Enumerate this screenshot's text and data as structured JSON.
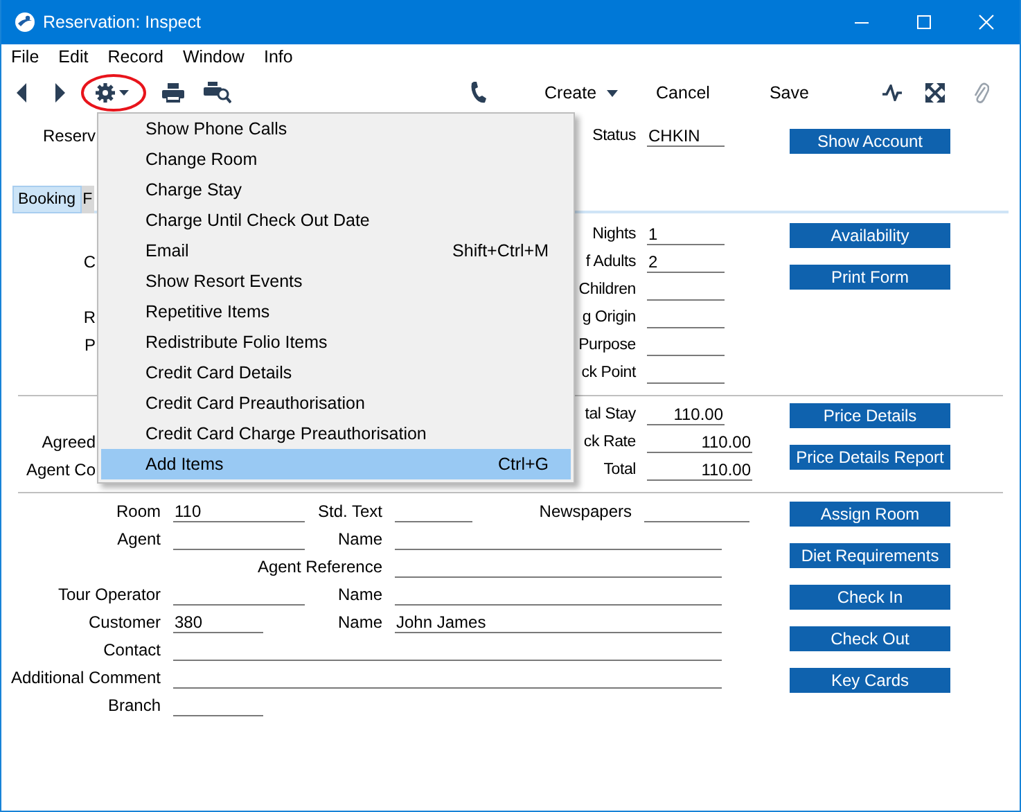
{
  "window": {
    "title": "Reservation: Inspect"
  },
  "menubar": [
    {
      "label": "File"
    },
    {
      "label": "Edit"
    },
    {
      "label": "Record"
    },
    {
      "label": "Window"
    },
    {
      "label": "Info"
    }
  ],
  "toolbar": {
    "buttons": [
      {
        "label": "Create",
        "kind": "dropdown"
      },
      {
        "label": "Cancel",
        "kind": "plain"
      },
      {
        "label": "Save",
        "kind": "plain"
      }
    ]
  },
  "header": {
    "left_label": "Reserv",
    "status_label": "Status",
    "status_value": "CHKIN",
    "button": "Show Account"
  },
  "tabs": [
    {
      "label": "Booking",
      "selected": true
    },
    {
      "label": "F",
      "selected": false
    }
  ],
  "booking": {
    "rows": [
      {
        "label": "Nights",
        "value": "1"
      },
      {
        "left_label": "C",
        "label": "f Adults",
        "value": "2"
      },
      {
        "label": "Children"
      },
      {
        "left_label": "R",
        "label": "g Origin"
      },
      {
        "left_label": "P",
        "label": "Purpose"
      },
      {
        "label": "ck Point"
      }
    ],
    "buttons": [
      "Availability",
      "Print Form"
    ]
  },
  "prices": {
    "rows": [
      {
        "label": "tal Stay",
        "value": "110.00"
      },
      {
        "left_label": "Agreed",
        "label": "ck Rate",
        "value": "110.00"
      },
      {
        "left_label": "Agent Co",
        "label": "Total",
        "value": "110.00"
      }
    ],
    "buttons": [
      "Price Details",
      "Price Details Report"
    ]
  },
  "guest": {
    "rows": [
      [
        {
          "label": "Room",
          "value": "110"
        },
        {
          "label": "Std. Text"
        },
        {
          "label": "Newspapers"
        }
      ],
      [
        {
          "label": "Agent"
        },
        {
          "label": "Name"
        }
      ],
      [
        {},
        {
          "label": "Agent Reference"
        }
      ],
      [
        {
          "label": "Tour Operator"
        },
        {
          "label": "Name"
        }
      ],
      [
        {
          "label": "Customer",
          "value": "380"
        },
        {
          "label": "Name",
          "value": "John James"
        }
      ],
      [
        {
          "label": "Contact"
        }
      ],
      [
        {
          "label": "Additional Comment"
        }
      ],
      [
        {
          "label": "Branch"
        }
      ]
    ],
    "buttons": [
      "Assign Room",
      "Diet Requirements",
      "Check In",
      "Check Out",
      "Key Cards"
    ]
  },
  "menu": {
    "items": [
      {
        "label": "Show Phone Calls",
        "selected": false
      },
      {
        "label": "Change Room",
        "selected": false
      },
      {
        "label": "Charge Stay",
        "selected": false
      },
      {
        "label": "Charge Until Check Out Date",
        "selected": false
      },
      {
        "label": "Email",
        "shortcut": "Shift+Ctrl+M",
        "selected": false
      },
      {
        "label": "Show Resort Events",
        "selected": false
      },
      {
        "label": "Repetitive Items",
        "selected": false
      },
      {
        "label": "Redistribute Folio Items",
        "selected": false
      },
      {
        "label": "Credit Card Details",
        "selected": false
      },
      {
        "label": "Credit Card Preauthorisation",
        "selected": false
      },
      {
        "label": "Credit Card Charge Preauthorisation",
        "selected": false
      },
      {
        "label": "Add Items",
        "shortcut": "Ctrl+G",
        "selected": true
      }
    ]
  }
}
